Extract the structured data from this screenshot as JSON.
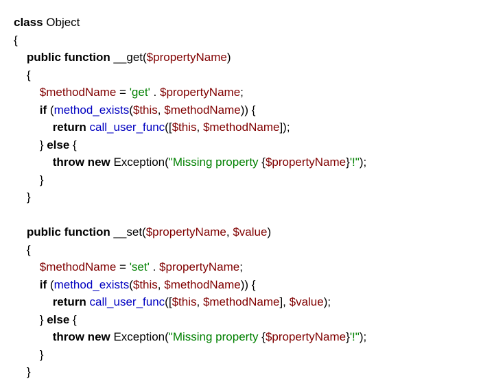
{
  "chart_data": {
    "type": "table",
    "title": "PHP class with magic __get and __set methods",
    "language": "php",
    "lines": [
      [
        [
          "kw",
          "class"
        ],
        [
          "plain",
          " Object"
        ]
      ],
      [
        [
          "plain",
          "{"
        ]
      ],
      [
        [
          "plain",
          "    "
        ],
        [
          "kw",
          "public function"
        ],
        [
          "plain",
          " __get("
        ],
        [
          "var",
          "$propertyName"
        ],
        [
          "plain",
          ")"
        ]
      ],
      [
        [
          "plain",
          "    {"
        ]
      ],
      [
        [
          "plain",
          "        "
        ],
        [
          "var",
          "$methodName"
        ],
        [
          "plain",
          " = "
        ],
        [
          "str",
          "'get'"
        ],
        [
          "plain",
          " . "
        ],
        [
          "var",
          "$propertyName"
        ],
        [
          "plain",
          ";"
        ]
      ],
      [
        [
          "plain",
          "        "
        ],
        [
          "kw",
          "if"
        ],
        [
          "plain",
          " ("
        ],
        [
          "fn",
          "method_exists"
        ],
        [
          "plain",
          "("
        ],
        [
          "var",
          "$this"
        ],
        [
          "plain",
          ", "
        ],
        [
          "var",
          "$methodName"
        ],
        [
          "plain",
          ")) {"
        ]
      ],
      [
        [
          "plain",
          "            "
        ],
        [
          "kw",
          "return"
        ],
        [
          "plain",
          " "
        ],
        [
          "fn",
          "call_user_func"
        ],
        [
          "plain",
          "(["
        ],
        [
          "var",
          "$this"
        ],
        [
          "plain",
          ", "
        ],
        [
          "var",
          "$methodName"
        ],
        [
          "plain",
          "]);"
        ]
      ],
      [
        [
          "plain",
          "        } "
        ],
        [
          "kw",
          "else"
        ],
        [
          "plain",
          " {"
        ]
      ],
      [
        [
          "plain",
          "            "
        ],
        [
          "kw",
          "throw new"
        ],
        [
          "plain",
          " Exception("
        ],
        [
          "str",
          "\"Missing property "
        ],
        [
          "plain",
          "{"
        ],
        [
          "var",
          "$propertyName"
        ],
        [
          "plain",
          "}"
        ],
        [
          "str",
          "'!\""
        ],
        [
          "plain",
          ");"
        ]
      ],
      [
        [
          "plain",
          "        }"
        ]
      ],
      [
        [
          "plain",
          "    }"
        ]
      ],
      [
        [
          "plain",
          ""
        ]
      ],
      [
        [
          "plain",
          "    "
        ],
        [
          "kw",
          "public function"
        ],
        [
          "plain",
          " __set("
        ],
        [
          "var",
          "$propertyName"
        ],
        [
          "plain",
          ", "
        ],
        [
          "var",
          "$value"
        ],
        [
          "plain",
          ")"
        ]
      ],
      [
        [
          "plain",
          "    {"
        ]
      ],
      [
        [
          "plain",
          "        "
        ],
        [
          "var",
          "$methodName"
        ],
        [
          "plain",
          " = "
        ],
        [
          "str",
          "'set'"
        ],
        [
          "plain",
          " . "
        ],
        [
          "var",
          "$propertyName"
        ],
        [
          "plain",
          ";"
        ]
      ],
      [
        [
          "plain",
          "        "
        ],
        [
          "kw",
          "if"
        ],
        [
          "plain",
          " ("
        ],
        [
          "fn",
          "method_exists"
        ],
        [
          "plain",
          "("
        ],
        [
          "var",
          "$this"
        ],
        [
          "plain",
          ", "
        ],
        [
          "var",
          "$methodName"
        ],
        [
          "plain",
          ")) {"
        ]
      ],
      [
        [
          "plain",
          "            "
        ],
        [
          "kw",
          "return"
        ],
        [
          "plain",
          " "
        ],
        [
          "fn",
          "call_user_func"
        ],
        [
          "plain",
          "(["
        ],
        [
          "var",
          "$this"
        ],
        [
          "plain",
          ", "
        ],
        [
          "var",
          "$methodName"
        ],
        [
          "plain",
          "], "
        ],
        [
          "var",
          "$value"
        ],
        [
          "plain",
          ");"
        ]
      ],
      [
        [
          "plain",
          "        } "
        ],
        [
          "kw",
          "else"
        ],
        [
          "plain",
          " {"
        ]
      ],
      [
        [
          "plain",
          "            "
        ],
        [
          "kw",
          "throw new"
        ],
        [
          "plain",
          " Exception("
        ],
        [
          "str",
          "\"Missing property "
        ],
        [
          "plain",
          "{"
        ],
        [
          "var",
          "$propertyName"
        ],
        [
          "plain",
          "}"
        ],
        [
          "str",
          "'!\""
        ],
        [
          "plain",
          ");"
        ]
      ],
      [
        [
          "plain",
          "        }"
        ]
      ],
      [
        [
          "plain",
          "    }"
        ]
      ]
    ]
  }
}
